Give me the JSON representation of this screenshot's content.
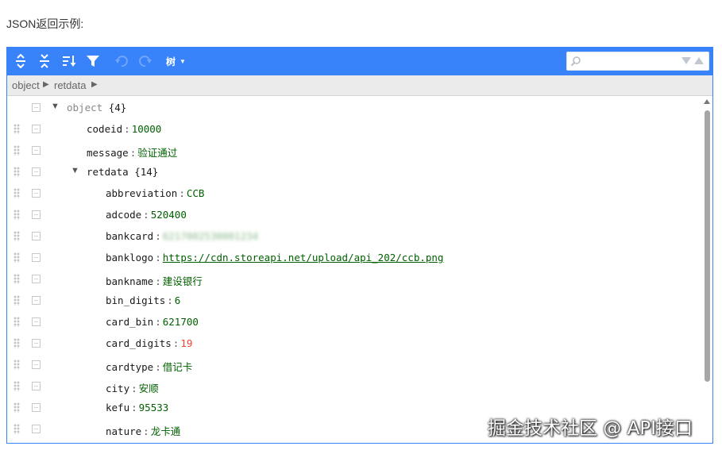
{
  "page": {
    "heading": "JSON返回示例:"
  },
  "toolbar": {
    "buttons": [
      {
        "name": "expand-all-icon",
        "title": "expand all"
      },
      {
        "name": "collapse-all-icon",
        "title": "collapse all"
      },
      {
        "name": "sort-icon",
        "title": "sort"
      },
      {
        "name": "filter-icon",
        "title": "filter"
      },
      {
        "name": "undo-icon",
        "title": "undo",
        "disabled": true
      },
      {
        "name": "redo-icon",
        "title": "redo",
        "disabled": true
      }
    ],
    "mode_label": "树",
    "search": {
      "value": "",
      "placeholder": ""
    }
  },
  "navbar": {
    "path": [
      "object",
      "retdata"
    ]
  },
  "tree": {
    "root": {
      "label": "object",
      "count": "{4}"
    },
    "codeid": {
      "key": "codeid",
      "value": "10000"
    },
    "message": {
      "key": "message",
      "value": "验证通过"
    },
    "retdata": {
      "key": "retdata",
      "count": "{14}"
    },
    "fields": [
      {
        "key": "abbreviation",
        "value": "CCB",
        "type": "string"
      },
      {
        "key": "adcode",
        "value": "520400",
        "type": "string"
      },
      {
        "key": "bankcard",
        "value": "6217002530001234",
        "type": "blurred"
      },
      {
        "key": "banklogo",
        "value": "https://cdn.storeapi.net/upload/api_202/ccb.png",
        "type": "url"
      },
      {
        "key": "bankname",
        "value": "建设银行",
        "type": "string"
      },
      {
        "key": "bin_digits",
        "value": "6",
        "type": "string"
      },
      {
        "key": "card_bin",
        "value": "621700",
        "type": "string"
      },
      {
        "key": "card_digits",
        "value": "19",
        "type": "number"
      },
      {
        "key": "cardtype",
        "value": "借记卡",
        "type": "string"
      },
      {
        "key": "city",
        "value": "安顺",
        "type": "string"
      },
      {
        "key": "kefu",
        "value": "95533",
        "type": "string"
      },
      {
        "key": "nature",
        "value": "龙卡通",
        "type": "string"
      }
    ],
    "separator": ":"
  },
  "watermark": "掘金技术社区 @ API接口",
  "colors": {
    "accent": "#3883fa",
    "string": "#006000",
    "number": "#ee422e"
  }
}
